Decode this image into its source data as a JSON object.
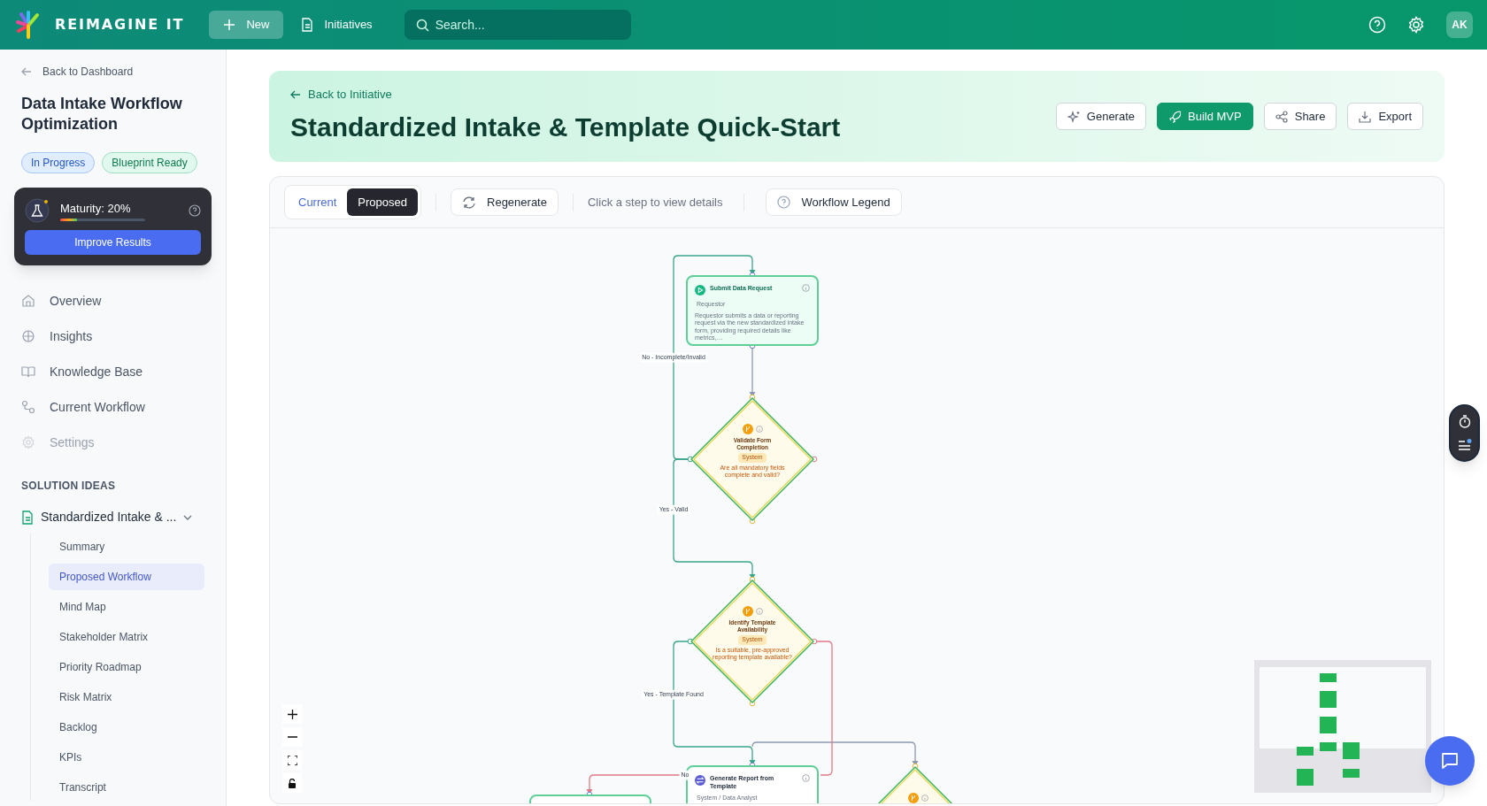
{
  "header": {
    "brand": "REIMAGINE IT",
    "new_button": "New",
    "initiatives_link": "Initiatives",
    "search": {
      "placeholder": "Search..."
    },
    "avatar": "AK"
  },
  "sidebar": {
    "back_link": "Back to Dashboard",
    "title": "Data Intake Workflow Optimization",
    "badges": [
      {
        "label": "In Progress",
        "kind": "status"
      },
      {
        "label": "Blueprint Ready",
        "kind": "ready"
      }
    ],
    "maturity": {
      "label": "Maturity: 20%",
      "level": 0.2,
      "button": "Improve Results"
    },
    "nav": [
      {
        "label": "Overview",
        "disabled": false
      },
      {
        "label": "Insights",
        "disabled": false
      },
      {
        "label": "Knowledge Base",
        "disabled": false
      },
      {
        "label": "Current Workflow",
        "disabled": false
      },
      {
        "label": "Settings",
        "disabled": true
      }
    ],
    "section_title": "SOLUTION IDEAS",
    "solution": {
      "label": "Standardized Intake & ...",
      "expanded": true,
      "children": [
        {
          "label": "Summary",
          "selected": false
        },
        {
          "label": "Proposed Workflow",
          "selected": true
        },
        {
          "label": "Mind Map",
          "selected": false
        },
        {
          "label": "Stakeholder Matrix",
          "selected": false
        },
        {
          "label": "Priority Roadmap",
          "selected": false
        },
        {
          "label": "Risk Matrix",
          "selected": false
        },
        {
          "label": "Backlog",
          "selected": false
        },
        {
          "label": "KPIs",
          "selected": false
        },
        {
          "label": "Transcript",
          "selected": false
        }
      ]
    }
  },
  "page": {
    "back_link": "Back to Initiative",
    "title": "Standardized Intake & Template Quick-Start",
    "actions": [
      {
        "label": "Generate",
        "kind": "outline"
      },
      {
        "label": "Build MVP",
        "kind": "primary"
      },
      {
        "label": "Share",
        "kind": "outline"
      },
      {
        "label": "Export",
        "kind": "outline"
      }
    ]
  },
  "toolbar": {
    "view_tabs": [
      {
        "label": "Current",
        "selected": false
      },
      {
        "label": "Proposed",
        "selected": true
      }
    ],
    "regenerate": "Regenerate",
    "hint": "Click a step to view details",
    "legend": "Workflow Legend"
  },
  "workflow": {
    "nodes": [
      {
        "kind": "start",
        "title": "Submit Data Request",
        "role": "Requestor",
        "description": "Requestor submits a data or reporting request via the new standardized intake form, providing required details like metrics,…"
      },
      {
        "kind": "decision",
        "title": "Validate Form Completion",
        "role": "System",
        "description": "Are all mandatory fields complete and valid?"
      },
      {
        "kind": "decision",
        "title": "Identify Template Availability",
        "role": "System",
        "description": "Is a suitable, pre-approved reporting template available?"
      },
      {
        "kind": "process",
        "title": "Generate Report from Template",
        "role": "System / Data Analyst"
      },
      {
        "kind": "process"
      },
      {
        "kind": "decision"
      }
    ],
    "edges": [
      {
        "kind": "success",
        "label": "No - Incomplete/Invalid"
      },
      {
        "kind": "neutral"
      },
      {
        "kind": "success",
        "label": "Yes - Valid"
      },
      {
        "kind": "success",
        "label": "Yes - Template Found"
      },
      {
        "kind": "neutral"
      },
      {
        "kind": "failure"
      },
      {
        "kind": "failure",
        "label": "No"
      }
    ]
  }
}
